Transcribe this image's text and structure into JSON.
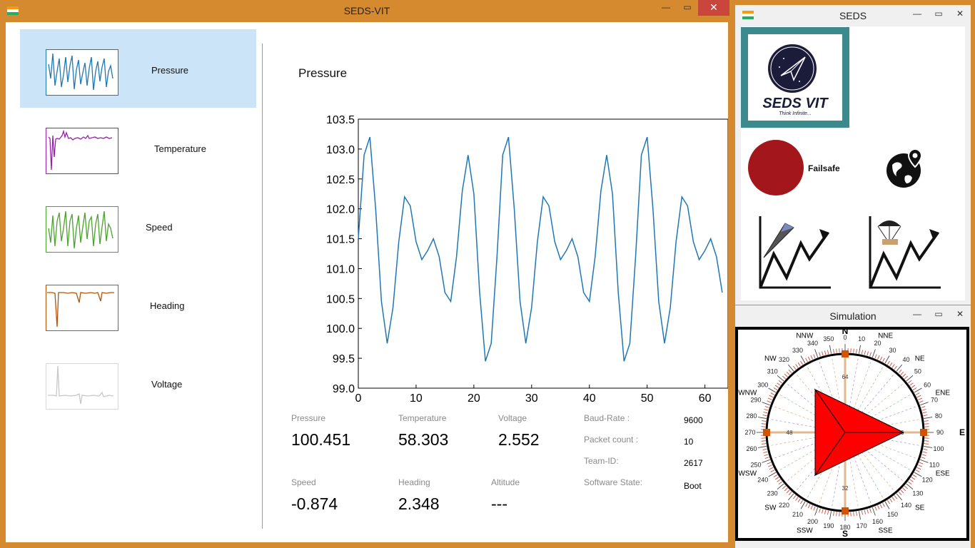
{
  "main_window": {
    "title": "SEDS-VIT",
    "controls": {
      "minimize": "—",
      "maximize": "▭",
      "close": "✕"
    },
    "sidebar": [
      {
        "label": "Pressure",
        "color": "#1f77b4"
      },
      {
        "label": "Temperature",
        "color": "#9a1fb0"
      },
      {
        "label": "Speed",
        "color": "#4aa32a"
      },
      {
        "label": "Heading",
        "color": "#b45309"
      },
      {
        "label": "Voltage",
        "color": "#c8c8c8"
      }
    ],
    "chart_title": "Pressure",
    "stats": {
      "pressure": {
        "label": "Pressure",
        "value": "100.451"
      },
      "temperature": {
        "label": "Temperature",
        "value": "58.303"
      },
      "voltage": {
        "label": "Voltage",
        "value": "2.552"
      },
      "speed": {
        "label": "Speed",
        "value": "-0.874"
      },
      "heading": {
        "label": "Heading",
        "value": "2.348"
      },
      "altitude": {
        "label": "Altitude",
        "value": "---"
      }
    },
    "info": {
      "baud_rate": {
        "label": "Baud-Rate :",
        "value": "9600"
      },
      "packet_count": {
        "label": "Packet count :",
        "value": "10"
      },
      "team_id": {
        "label": "Team-ID:",
        "value": "2617"
      },
      "software_state": {
        "label": "Software State:",
        "value": "Boot"
      }
    }
  },
  "seds_window": {
    "title": "SEDS",
    "logo_text": "SEDS VIT",
    "logo_tagline": "Think Infinite...",
    "failsafe_label": "Failsafe",
    "icons": [
      "globe-location-icon",
      "glider-graph-icon",
      "parachute-graph-icon"
    ]
  },
  "sim_window": {
    "title": "Simulation",
    "compass": {
      "north": "N",
      "east": "E",
      "south": "S",
      "intercardinal": [
        "NNE",
        "NE",
        "ENE",
        "ESE",
        "SE",
        "SSE",
        "SSW",
        "SW",
        "WSW",
        "WNW",
        "NW",
        "NNW"
      ],
      "ring_ticks": [
        64,
        48,
        32,
        96
      ]
    }
  },
  "chart_data": {
    "type": "line",
    "title": "",
    "xlabel": "",
    "ylabel": "",
    "xlim": [
      0,
      64
    ],
    "ylim": [
      99.0,
      103.5
    ],
    "xticks": [
      0,
      10,
      20,
      30,
      40,
      50,
      60
    ],
    "yticks": [
      99.0,
      99.5,
      100.0,
      100.5,
      101.0,
      101.5,
      102.0,
      102.5,
      103.0,
      103.5
    ],
    "color": "#1f77b4",
    "series": [
      {
        "x": [
          0,
          1,
          2,
          3,
          4,
          5,
          6,
          7,
          8,
          9,
          10,
          11,
          12,
          13,
          14,
          15,
          16,
          17,
          18,
          19,
          20,
          21,
          22,
          23,
          24,
          25,
          26,
          27,
          28,
          29,
          30,
          31,
          32,
          33,
          34,
          35,
          36,
          37,
          38,
          39,
          40,
          41,
          42,
          43,
          44,
          45,
          46,
          47,
          48,
          49,
          50,
          51,
          52,
          53,
          54,
          55,
          56,
          57,
          58,
          59,
          60,
          61,
          62,
          63
        ],
        "values": [
          101.5,
          102.9,
          103.2,
          102.0,
          100.45,
          99.75,
          100.35,
          101.45,
          102.2,
          102.05,
          101.45,
          101.15,
          101.3,
          101.5,
          101.2,
          100.6,
          100.45,
          101.2,
          102.3,
          102.9,
          102.25,
          100.6,
          99.45,
          99.75,
          101.2,
          102.9,
          103.2,
          102.0,
          100.45,
          99.75,
          100.35,
          101.45,
          102.2,
          102.05,
          101.45,
          101.15,
          101.3,
          101.5,
          101.2,
          100.6,
          100.45,
          101.2,
          102.3,
          102.9,
          102.25,
          100.6,
          99.45,
          99.75,
          101.2,
          102.9,
          103.2,
          102.0,
          100.45,
          99.75,
          100.35,
          101.45,
          102.2,
          102.05,
          101.45,
          101.15,
          101.3,
          101.5,
          101.2,
          100.6
        ]
      }
    ]
  }
}
